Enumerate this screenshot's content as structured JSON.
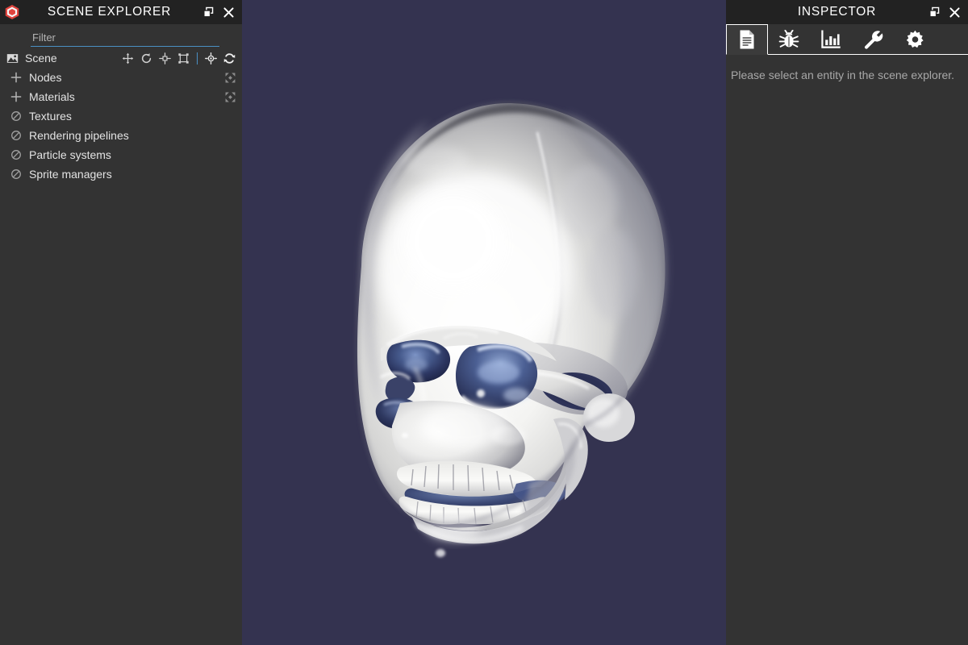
{
  "explorer": {
    "title": "SCENE EXPLORER",
    "logo_icon": "babylon-logo-icon",
    "popout_icon": "popout-icon",
    "close_icon": "close-icon",
    "filter": {
      "value": "",
      "placeholder": "Filter"
    },
    "scene_row": {
      "label": "Scene",
      "icon": "scene-image-icon",
      "tools": [
        {
          "name": "translate-gizmo-icon",
          "title": "Translation"
        },
        {
          "name": "rotate-gizmo-icon",
          "title": "Rotation"
        },
        {
          "name": "scale-gizmo-icon",
          "title": "Scaling"
        },
        {
          "name": "bounding-box-gizmo-icon",
          "title": "Bounding box"
        },
        {
          "name": "separator",
          "title": ""
        },
        {
          "name": "pick-target-icon",
          "title": "Pick"
        },
        {
          "name": "refresh-icon",
          "title": "Refresh"
        }
      ]
    },
    "tree_items": [
      {
        "label": "Nodes",
        "icon": "plus-icon",
        "expandable": true,
        "expand_icon": "expand-all-icon"
      },
      {
        "label": "Materials",
        "icon": "plus-icon",
        "expandable": true,
        "expand_icon": "expand-all-icon"
      },
      {
        "label": "Textures",
        "icon": "empty-circle-slash-icon",
        "expandable": false,
        "expand_icon": ""
      },
      {
        "label": "Rendering pipelines",
        "icon": "empty-circle-slash-icon",
        "expandable": false,
        "expand_icon": ""
      },
      {
        "label": "Particle systems",
        "icon": "empty-circle-slash-icon",
        "expandable": false,
        "expand_icon": ""
      },
      {
        "label": "Sprite managers",
        "icon": "empty-circle-slash-icon",
        "expandable": false,
        "expand_icon": ""
      }
    ]
  },
  "inspector": {
    "title": "INSPECTOR",
    "popout_icon": "popout-icon",
    "close_icon": "close-icon",
    "tabs": [
      {
        "name": "tab-properties",
        "icon": "document-icon",
        "active": true
      },
      {
        "name": "tab-debug",
        "icon": "bug-icon",
        "active": false
      },
      {
        "name": "tab-statistics",
        "icon": "bar-chart-icon",
        "active": false
      },
      {
        "name": "tab-tools",
        "icon": "wrench-icon",
        "active": false
      },
      {
        "name": "tab-settings",
        "icon": "gear-icon",
        "active": false
      }
    ],
    "message": "Please select an entity in the scene explorer."
  },
  "viewport": {
    "name": "babylon-3d-canvas",
    "background_color": "#343350",
    "model": "human-skull",
    "model_material_color": "#f2f2f0",
    "model_cavity_color": "#2b3c63"
  },
  "colors": {
    "panel_bg": "#333333",
    "titlebar_bg": "#222222",
    "accent": "#4a90c4",
    "text": "#e3e3e3",
    "muted_text": "#a8a8a8",
    "logo_red": "#e0443e"
  }
}
